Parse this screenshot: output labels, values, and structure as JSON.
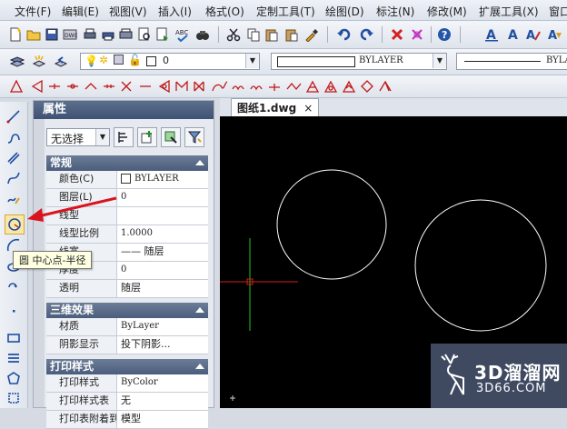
{
  "menu": [
    "文件(F)",
    "编辑(E)",
    "视图(V)",
    "插入(I)",
    "格式(O)",
    "定制工具(T)",
    "绘图(D)",
    "标注(N)",
    "修改(M)",
    "扩展工具(X)",
    "窗口"
  ],
  "layer_toolbar": {
    "layer_value": "0",
    "color_value": "BYLAYER",
    "linetype_value": "BYLA"
  },
  "properties_panel": {
    "title": "属性",
    "selection": "无选择",
    "categories": [
      {
        "name": "常规",
        "rows": [
          {
            "key": "颜色(C)",
            "value": "BYLAYER"
          },
          {
            "key": "图层(L)",
            "value": "0"
          },
          {
            "key": "线型",
            "value": ""
          },
          {
            "key": "线型比例",
            "value": "1.0000"
          },
          {
            "key": "线宽",
            "value": "—— 随层"
          },
          {
            "key": "厚度",
            "value": "0"
          },
          {
            "key": "透明",
            "value": "随层"
          }
        ]
      },
      {
        "name": "三维效果",
        "rows": [
          {
            "key": "材质",
            "value": "ByLayer"
          },
          {
            "key": "阴影显示",
            "value": "投下阴影..."
          }
        ]
      },
      {
        "name": "打印样式",
        "rows": [
          {
            "key": "打印样式",
            "value": "ByColor"
          },
          {
            "key": "打印样式表",
            "value": "无"
          },
          {
            "key": "打印表附着到",
            "value": "模型"
          }
        ]
      }
    ]
  },
  "document_tab": {
    "label": "图纸1.dwg",
    "close": "×"
  },
  "tooltip": {
    "text": "圆 中心点-半径"
  },
  "watermark": {
    "title": "3D溜溜网",
    "subtitle": "3D66.COM"
  },
  "colors": {
    "canvas": "#000000",
    "crosshair_red": "#d01e1e",
    "crosshair_green": "#1ec81e",
    "arrow_red": "#d8141e",
    "circle": "#ffffff"
  }
}
